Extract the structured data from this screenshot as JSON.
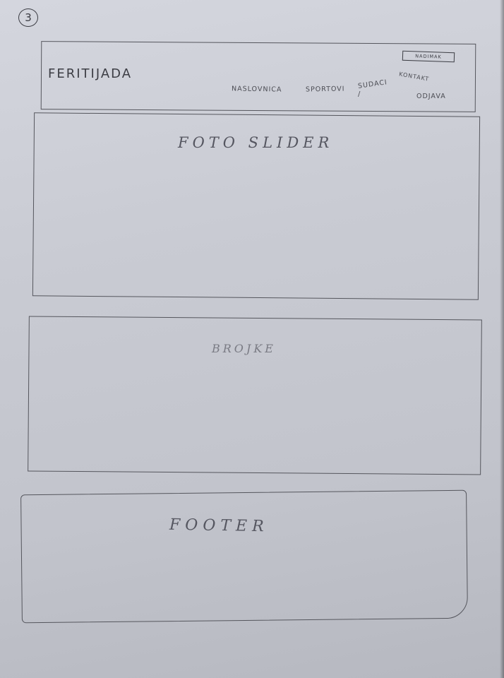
{
  "page_number": "3",
  "header": {
    "logo": "FERITIJADA",
    "nav": {
      "naslovnica": "NASLOVNICA",
      "sportovi": "SPORTOVI",
      "sudaci": "SUDACI",
      "slash": "/",
      "kontakt": "KONTAKT",
      "odjava": "ODJAVA"
    },
    "login_button": "NADIMAK"
  },
  "sections": {
    "slider": "FOTO SLIDER",
    "numbers": "BROJKE",
    "footer": "FOOTER"
  }
}
